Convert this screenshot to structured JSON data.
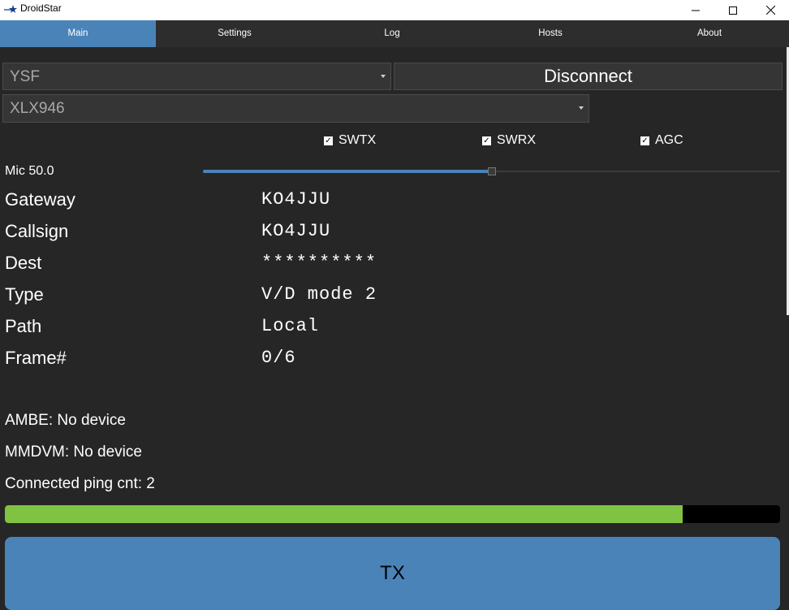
{
  "window": {
    "title": "DroidStar",
    "minimize_icon": "minimize-icon",
    "maximize_icon": "maximize-icon",
    "close_icon": "close-icon"
  },
  "tabs": [
    {
      "label": "Main",
      "active": true
    },
    {
      "label": "Settings",
      "active": false
    },
    {
      "label": "Log",
      "active": false
    },
    {
      "label": "Hosts",
      "active": false
    },
    {
      "label": "About",
      "active": false
    }
  ],
  "mode_select": {
    "value": "YSF"
  },
  "connect_button": {
    "label": "Disconnect"
  },
  "host_select": {
    "value": "XLX946"
  },
  "checkboxes": [
    {
      "label": "SWTX",
      "checked": true
    },
    {
      "label": "SWRX",
      "checked": true
    },
    {
      "label": "AGC",
      "checked": true
    }
  ],
  "mic": {
    "label": "Mic 50.0",
    "level_percent": 50
  },
  "info": [
    {
      "label": "Gateway",
      "value": "KO4JJU"
    },
    {
      "label": "Callsign",
      "value": "KO4JJU"
    },
    {
      "label": "Dest",
      "value": "**********"
    },
    {
      "label": "Type",
      "value": "V/D mode 2"
    },
    {
      "label": "Path",
      "value": "Local"
    },
    {
      "label": "Frame#",
      "value": "0/6"
    }
  ],
  "status": {
    "ambe": "AMBE: No device",
    "mmdvm": "MMDVM: No device",
    "connection": "Connected ping cnt: 2"
  },
  "progress": {
    "fraction": 0.874
  },
  "colors": {
    "accent": "#4a83b8",
    "progress": "#80c342",
    "background": "#262626"
  },
  "tx_button": {
    "label": "TX"
  }
}
